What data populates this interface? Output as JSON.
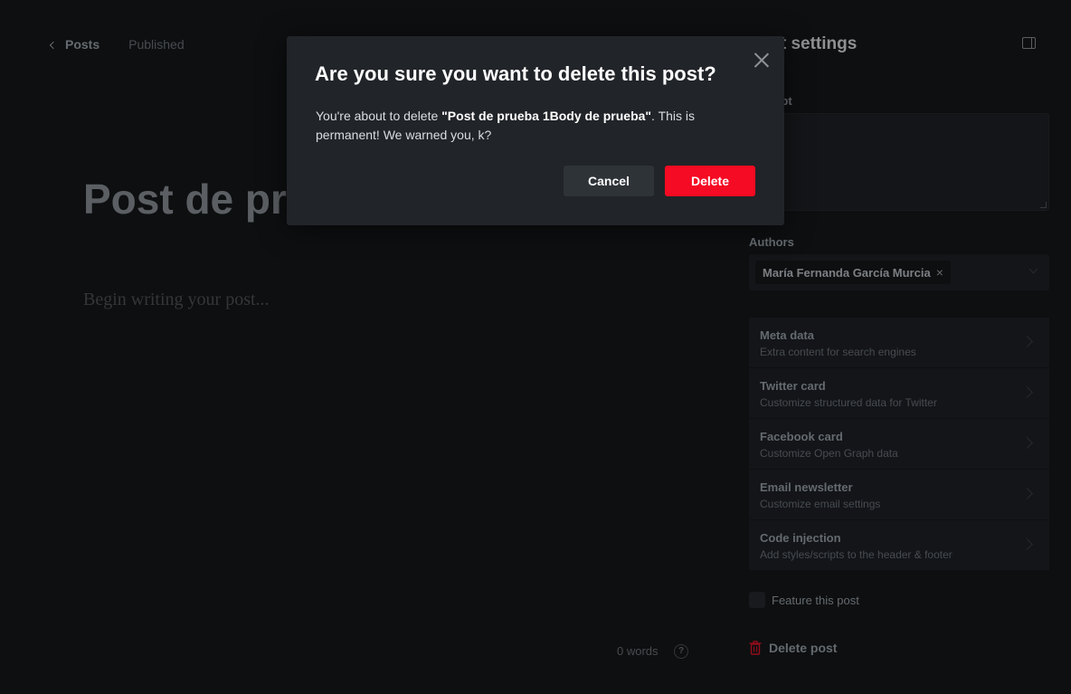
{
  "editor": {
    "back_label": "Posts",
    "status": "Published",
    "title": "Post de prueba",
    "body_placeholder": "Begin writing your post...",
    "word_count": "0 words",
    "help_glyph": "?"
  },
  "panel": {
    "title": "Post settings",
    "excerpt_label": "Excerpt",
    "authors_label": "Authors",
    "author_name": "María Fernanda García Murcia",
    "author_remove_glyph": "×",
    "menu": [
      {
        "title": "Meta data",
        "subtitle": "Extra content for search engines"
      },
      {
        "title": "Twitter card",
        "subtitle": "Customize structured data for Twitter"
      },
      {
        "title": "Facebook card",
        "subtitle": "Customize Open Graph data"
      },
      {
        "title": "Email newsletter",
        "subtitle": "Customize email settings"
      },
      {
        "title": "Code injection",
        "subtitle": "Add styles/scripts to the header & footer"
      }
    ],
    "feature_label": "Feature this post",
    "delete_label": "Delete post"
  },
  "modal": {
    "title": "Are you sure you want to delete this post?",
    "text_prefix": "You're about to delete ",
    "post_name": "\"Post de prueba 1Body de prueba\"",
    "text_suffix": ". This is permanent! We warned you, k?",
    "cancel_label": "Cancel",
    "delete_label": "Delete"
  },
  "colors": {
    "background": "#151719",
    "modal_background": "#212428",
    "danger": "#f50b23"
  },
  "icons": {
    "back": "chevron-left-icon",
    "help": "help-circle-icon",
    "panel_toggle": "sidebar-toggle-icon",
    "menu_chevron": "chevron-right-icon",
    "trash": "trash-icon",
    "close": "close-icon"
  }
}
